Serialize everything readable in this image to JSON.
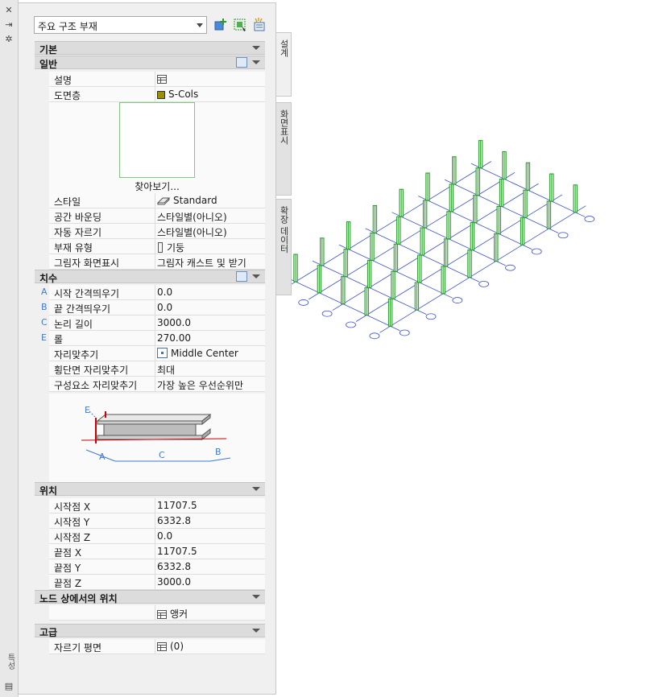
{
  "type_selector": {
    "value": "주요 구조 부재"
  },
  "palette_title": "특성",
  "tabs": [
    "설계",
    "화면표시",
    "확장 데이터"
  ],
  "sections": {
    "basic": "기본",
    "general": "일반",
    "dimensions": "치수",
    "location": "위치",
    "node_location": "노드 상에서의 위치",
    "advanced": "고급"
  },
  "general": [
    {
      "key": "설명",
      "value": ""
    },
    {
      "key": "도면층",
      "value": "S-Cols"
    }
  ],
  "browse_label": "찾아보기...",
  "general2": [
    {
      "key": "스타일",
      "value": "Standard"
    },
    {
      "key": "공간 바운딩",
      "value": "스타일별(아니오)"
    },
    {
      "key": "자동 자르기",
      "value": "스타일별(아니오)"
    },
    {
      "key": "부재 유형",
      "value": "기둥"
    },
    {
      "key": "그림자 화면표시",
      "value": "그림자 캐스트 및 받기"
    }
  ],
  "dimensions": [
    {
      "letter": "A",
      "key": "시작 간격띄우기",
      "value": "0.0"
    },
    {
      "letter": "B",
      "key": "끝 간격띄우기",
      "value": "0.0"
    },
    {
      "letter": "C",
      "key": "논리 길이",
      "value": "3000.0"
    },
    {
      "letter": "E",
      "key": "롤",
      "value": "270.00"
    },
    {
      "letter": "",
      "key": "자리맞추기",
      "value": "Middle Center"
    },
    {
      "letter": "",
      "key": "횡단면 자리맞추기",
      "value": "최대"
    },
    {
      "letter": "",
      "key": "구성요소 자리맞추기",
      "value": "가장 높은 우선순위만"
    }
  ],
  "diagram_labels": {
    "a": "A",
    "b": "B",
    "c": "C",
    "e": "E"
  },
  "location": [
    {
      "key": "시작점 X",
      "value": "11707.5"
    },
    {
      "key": "시작점 Y",
      "value": "6332.8"
    },
    {
      "key": "시작점 Z",
      "value": "0.0"
    },
    {
      "key": "끝점 X",
      "value": "11707.5"
    },
    {
      "key": "끝점 Y",
      "value": "6332.8"
    },
    {
      "key": "끝점 Z",
      "value": "3000.0"
    }
  ],
  "node_location": {
    "value": "앵커"
  },
  "advanced": [
    {
      "key": "자르기 평면",
      "value": "(0)"
    }
  ],
  "colors": {
    "grid_line": "#3a4fd6",
    "column": "#1f9a1f",
    "section_bg": "#dcdcdc"
  }
}
